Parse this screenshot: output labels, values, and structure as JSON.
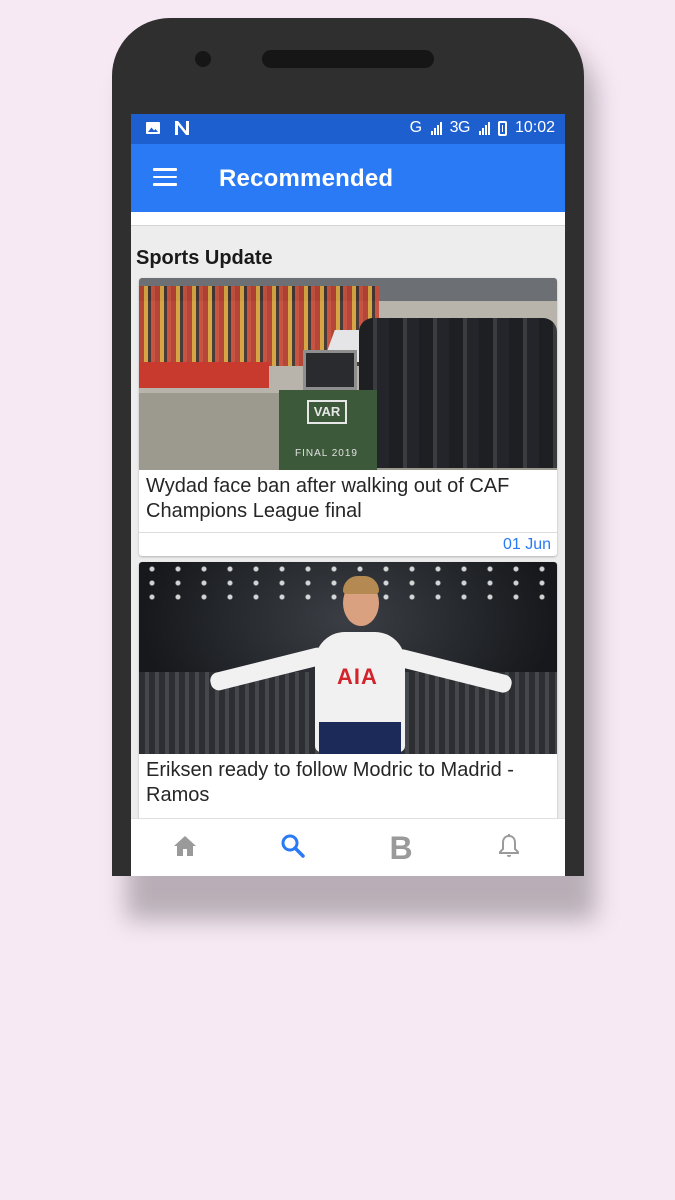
{
  "colors": {
    "page_background": "#f7e9f4",
    "status_bar": "#1e5fd0",
    "app_bar": "#2a7af5",
    "accent": "#2a7af5",
    "nav_inactive": "#9a9a9a"
  },
  "status_bar": {
    "network": "G",
    "network2": "3G",
    "time": "10:02",
    "icons": [
      "image-icon",
      "n-notification-icon",
      "signal-icon",
      "battery-charging-icon"
    ]
  },
  "app_bar": {
    "title": "Recommended",
    "menu_icon": "hamburger-menu-icon"
  },
  "section": {
    "title": "Sports Update"
  },
  "articles": [
    {
      "headline": "Wydad face ban after walking out of CAF Champions League final",
      "date": "01 Jun",
      "image_text": {
        "var": "VAR",
        "final": "FINAL 2019"
      }
    },
    {
      "headline": "Eriksen ready to follow Modric to Madrid - Ramos",
      "image_text": {
        "sponsor": "AIA"
      }
    }
  ],
  "bottom_nav": {
    "items": [
      {
        "icon": "home-icon",
        "active": false
      },
      {
        "icon": "search-icon",
        "active": true
      },
      {
        "icon": "b-icon",
        "label": "B",
        "active": false
      },
      {
        "icon": "bell-icon",
        "active": false
      }
    ]
  }
}
